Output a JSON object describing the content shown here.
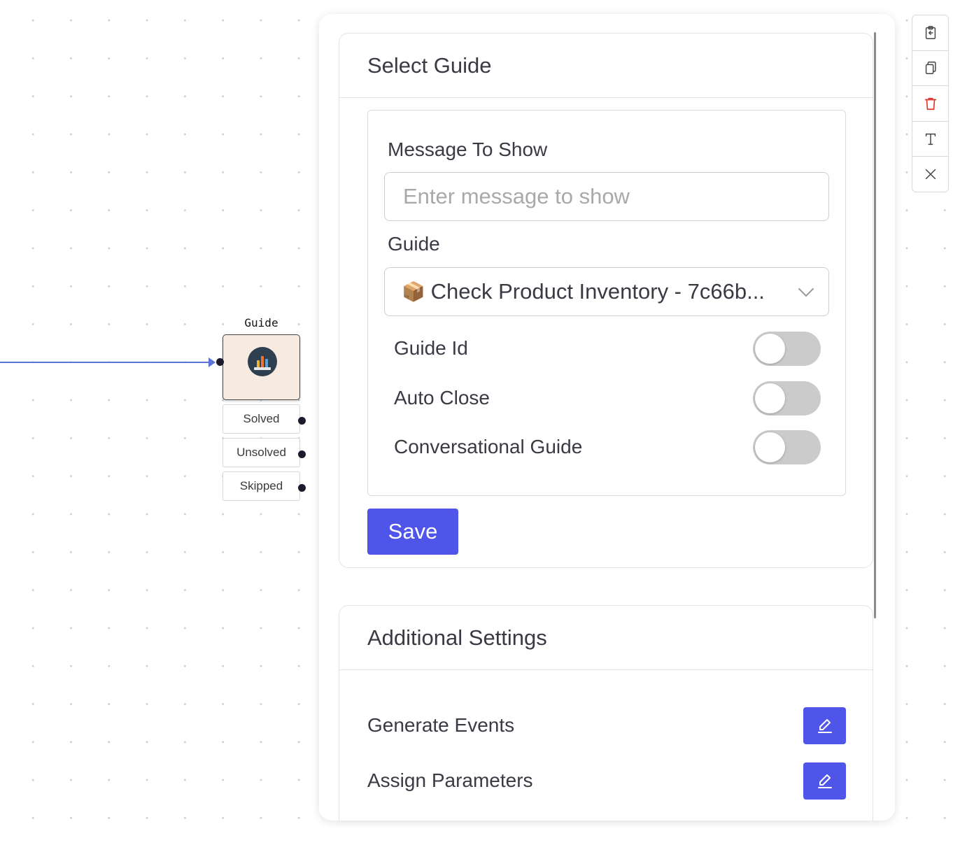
{
  "canvas": {
    "node": {
      "title": "Guide",
      "outcomes": [
        "Solved",
        "Unsolved",
        "Skipped"
      ]
    }
  },
  "select_guide": {
    "title": "Select Guide",
    "message_label": "Message To Show",
    "message_placeholder": "Enter message to show",
    "message_value": "",
    "guide_label": "Guide",
    "guide_emoji": "📦",
    "guide_value": "Check Product Inventory - 7c66b...",
    "toggles": [
      {
        "label": "Guide Id",
        "on": false
      },
      {
        "label": "Auto Close",
        "on": false
      },
      {
        "label": "Conversational Guide",
        "on": false
      }
    ],
    "save_label": "Save"
  },
  "additional_settings": {
    "title": "Additional Settings",
    "rows": [
      {
        "label": "Generate Events"
      },
      {
        "label": "Assign Parameters"
      }
    ]
  },
  "colors": {
    "accent": "#4f55e8",
    "edge": "#5b72d6",
    "node_fill": "#f6eae1",
    "delete_icon": "#e0352b"
  },
  "toolbar": {
    "icons": [
      "paste-icon",
      "copy-icon",
      "trash-icon",
      "text-icon",
      "close-icon"
    ]
  }
}
